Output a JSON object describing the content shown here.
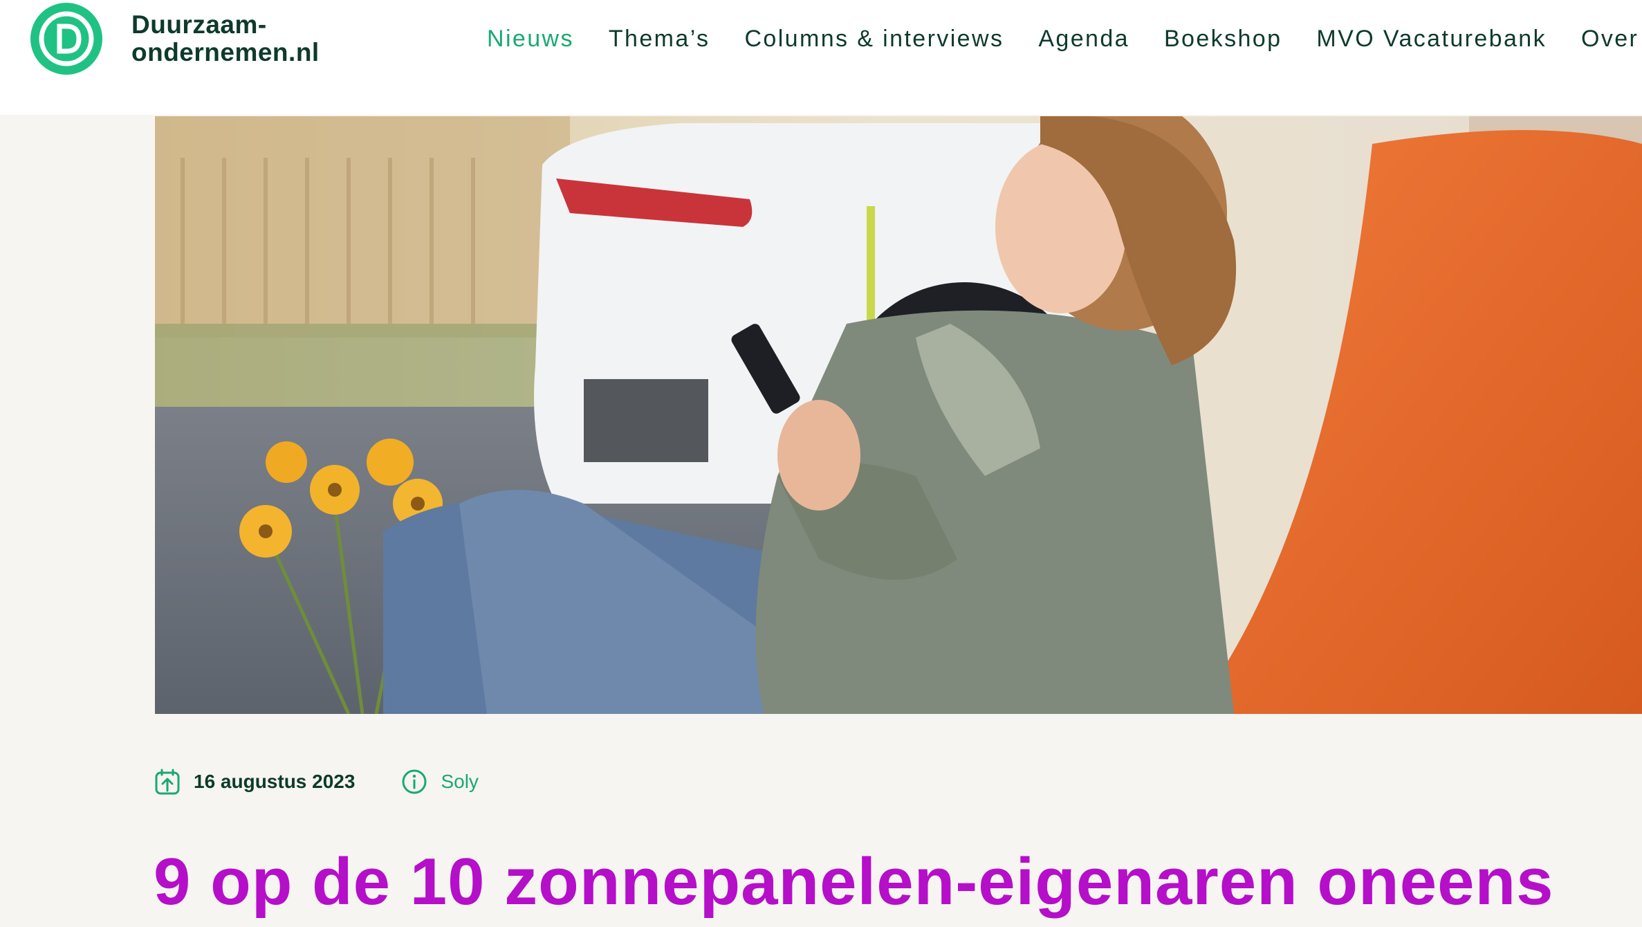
{
  "brand": {
    "line1": "Duurzaam-",
    "line2": "ondernemen.nl",
    "color": "#1fc283"
  },
  "nav": {
    "items": [
      {
        "label": "Nieuws",
        "active": true
      },
      {
        "label": "Thema’s"
      },
      {
        "label": "Columns & interviews"
      },
      {
        "label": "Agenda"
      },
      {
        "label": "Boekshop"
      },
      {
        "label": "MVO Vacaturebank"
      },
      {
        "label": "Over"
      }
    ]
  },
  "hero": {
    "image_icon": "photo-woman-phone-orange-chair-ev-charging"
  },
  "article": {
    "date": "16 augustus 2023",
    "source": "Soly",
    "title": "9 op de 10 zonnepanelen-eigenaren oneens"
  },
  "colors": {
    "accent": "#1aa874",
    "dark": "#0e3a2a",
    "title": "#b50fc9",
    "background": "#f6f5f2"
  }
}
